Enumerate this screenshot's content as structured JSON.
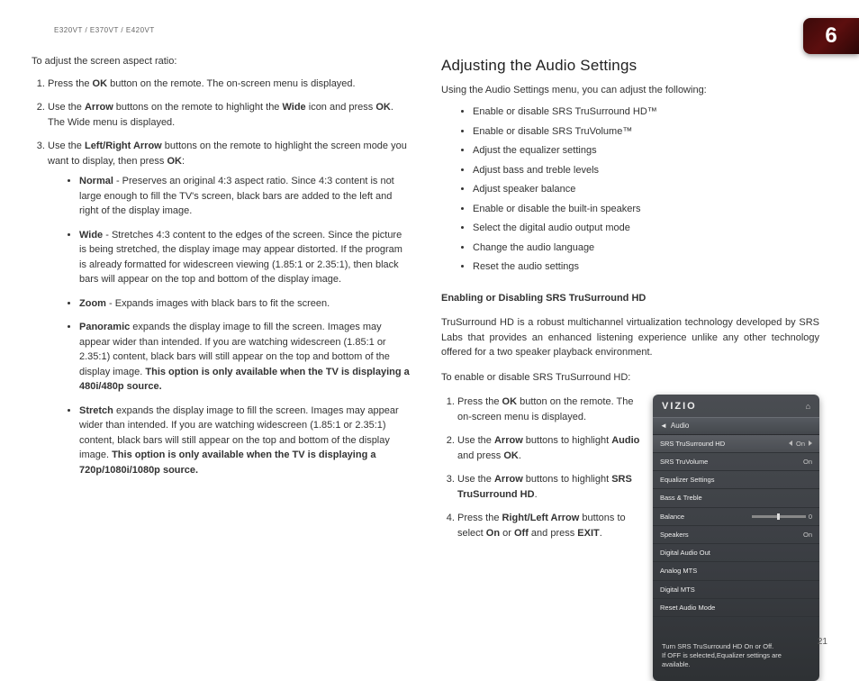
{
  "header": {
    "model": "E320VT / E370VT / E420VT",
    "chapter": "6"
  },
  "page_number": "21",
  "left": {
    "intro": "To adjust the screen aspect ratio:",
    "steps": {
      "s1a": "Press the ",
      "s1b": "OK",
      "s1c": " button on the remote. The on-screen menu is displayed.",
      "s2a": "Use the ",
      "s2b": "Arrow",
      "s2c": " buttons on the remote to highlight the ",
      "s2d": "Wide",
      "s2e": " icon and press ",
      "s2f": "OK",
      "s2g": ". The Wide menu is displayed.",
      "s3a": "Use the ",
      "s3b": "Left/Right Arrow",
      "s3c": " buttons on the remote to highlight the screen mode you want to display, then press ",
      "s3d": "OK",
      "s3e": ":"
    },
    "modes": {
      "normal_label": "Normal",
      "normal_text": " - Preserves an original 4:3 aspect ratio. Since 4:3 content is not large enough to fill the TV's screen, black bars are added to the left and right of the display image.",
      "wide_label": "Wide",
      "wide_text": " - Stretches 4:3 content to the edges of the screen. Since the picture is being stretched, the display image may appear distorted. If the program is already formatted for widescreen viewing (1.85:1 or 2.35:1), then black bars will appear on the top and bottom of the display image.",
      "zoom_label": "Zoom",
      "zoom_text": " - Expands images with black bars to fit the screen.",
      "pan_label": "Panoramic",
      "pan_text": " expands the display image to fill the screen. Images may appear wider than intended. If you are watching widescreen (1.85:1 or 2.35:1) content, black bars will still appear on the top and bottom of the display image. ",
      "pan_bold": "This option is only available when the TV is displaying a 480i/480p source.",
      "stretch_label": "Stretch",
      "stretch_text": " expands the display image to fill the screen. Images may appear wider than intended. If you are watching widescreen (1.85:1 or 2.35:1) content, black bars will still appear on the top and bottom of the display image. ",
      "stretch_bold": "This option is only available when the TV is displaying a 720p/1080i/1080p source."
    }
  },
  "right": {
    "title": "Adjusting the Audio Settings",
    "intro": "Using the Audio Settings menu, you can adjust the following:",
    "bullets": {
      "b0": "Enable or disable SRS TruSurround HD™",
      "b1": "Enable or disable SRS TruVolume™",
      "b2": "Adjust the equalizer settings",
      "b3": "Adjust bass and treble levels",
      "b4": "Adjust speaker balance",
      "b5": "Enable or disable the built-in speakers",
      "b6": "Select the digital audio output mode",
      "b7": "Change the audio language",
      "b8": "Reset the audio settings"
    },
    "sub_heading": "Enabling or Disabling SRS TruSurround HD",
    "srs_desc": "TruSurround HD is a robust multichannel virtualization technology developed by SRS Labs that provides an enhanced listening experience unlike any other technology offered for a two speaker playback environment.",
    "srs_intro": "To enable or disable SRS TruSurround HD:",
    "srs_steps": {
      "s1a": "Press the ",
      "s1b": "OK",
      "s1c": " button on the remote. The on-screen menu is displayed.",
      "s2a": "Use the ",
      "s2b": "Arrow",
      "s2c": " buttons to highlight ",
      "s2d": "Audio",
      "s2e": " and press ",
      "s2f": "OK",
      "s2g": ".",
      "s3a": "Use the ",
      "s3b": "Arrow",
      "s3c": " buttons to highlight ",
      "s3d": "SRS TruSurround HD",
      "s3e": ".",
      "s4a": "Press the ",
      "s4b": "Right/Left Arrow",
      "s4c": " buttons to select ",
      "s4d": "On",
      "s4e": " or ",
      "s4f": "Off",
      "s4g": " and press ",
      "s4h": "EXIT",
      "s4i": "."
    }
  },
  "menu": {
    "logo": "VIZIO",
    "breadcrumb": "Audio",
    "rows": {
      "r0": {
        "label": "SRS TruSurround HD",
        "value": "On"
      },
      "r1": {
        "label": "SRS TruVolume",
        "value": "On"
      },
      "r2": {
        "label": "Equalizer Settings",
        "value": ""
      },
      "r3": {
        "label": "Bass & Treble",
        "value": ""
      },
      "r4": {
        "label": "Balance",
        "value": "0"
      },
      "r5": {
        "label": "Speakers",
        "value": "On"
      },
      "r6": {
        "label": "Digital Audio Out",
        "value": ""
      },
      "r7": {
        "label": "Analog MTS",
        "value": ""
      },
      "r8": {
        "label": "Digital MTS",
        "value": ""
      },
      "r9": {
        "label": "Reset Audio Mode",
        "value": ""
      }
    },
    "help1": "Turn SRS TruSurround HD On or Off.",
    "help2": "If OFF is selected,Equalizer settings are available."
  }
}
